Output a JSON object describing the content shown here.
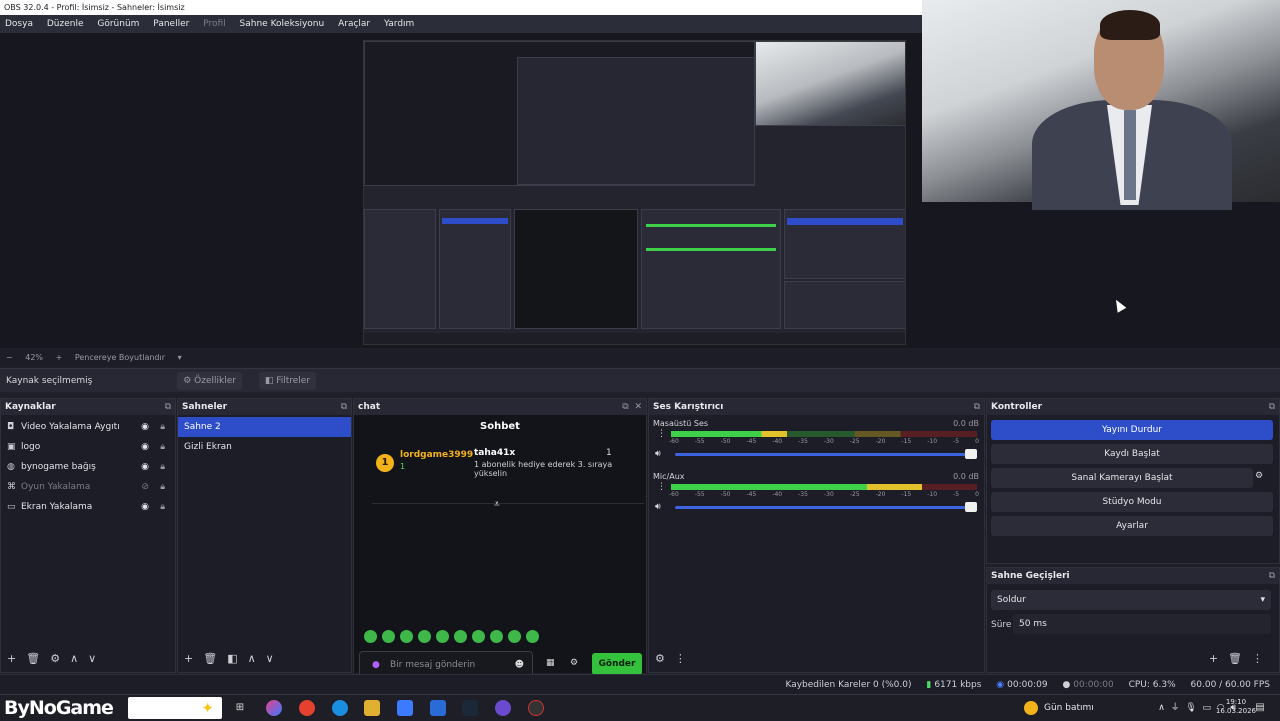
{
  "window": {
    "title": "OBS 32.0.4 - Profil: İsimsiz - Sahneler: İsimsiz"
  },
  "menu": [
    "Dosya",
    "Düzenle",
    "Görünüm",
    "Paneller",
    "Profil",
    "Sahne Koleksiyonu",
    "Araçlar",
    "Yardım"
  ],
  "zoom": {
    "minus": "−",
    "value": "42%",
    "plus": "+",
    "fit_label": "Pencereye Boyutlandır",
    "chevron": "▾"
  },
  "source_toolbar": {
    "status": "Kaynak seçilmemiş",
    "properties": "Özellikler",
    "filters": "Filtreler"
  },
  "sources": {
    "title": "Kaynaklar",
    "items": [
      {
        "label": "Video Yakalama Aygıtı",
        "icon": "camera-icon"
      },
      {
        "label": "logo",
        "icon": "image-icon"
      },
      {
        "label": "bynogame bağış",
        "icon": "globe-icon"
      },
      {
        "label": "Oyun Yakalama",
        "icon": "gamepad-icon",
        "hidden": true
      },
      {
        "label": "Ekran Yakalama",
        "icon": "monitor-icon"
      }
    ]
  },
  "scenes": {
    "title": "Sahneler",
    "items": [
      "Sahne 2",
      "Gizli Ekran"
    ],
    "selected": 0
  },
  "chat": {
    "dock_title": "chat",
    "header": "Sohbet",
    "gift": {
      "badge": "1",
      "sender": "lordgame3999",
      "sender_count": "1",
      "recipient": "taha41x",
      "recipient_count": "1",
      "message": "1 abonelik hediye ederek 3. sıraya yükselin"
    },
    "input_placeholder": "Bir mesaj gönderin",
    "send_label": "Gönder"
  },
  "mixer": {
    "title": "Ses Karıştırıcı",
    "channels": [
      {
        "name": "Masaüstü Ses",
        "db": "0.0 dB",
        "level": 0.38
      },
      {
        "name": "Mic/Aux",
        "db": "0.0 dB",
        "level": 0.82
      }
    ],
    "ticks": [
      "-60",
      "-55",
      "-50",
      "-45",
      "-40",
      "-35",
      "-30",
      "-25",
      "-20",
      "-15",
      "-10",
      "-5",
      "0"
    ]
  },
  "controls": {
    "title": "Kontroller",
    "stop_stream": "Yayını Durdur",
    "start_record": "Kaydı Başlat",
    "start_vcam": "Sanal Kamerayı Başlat",
    "studio_mode": "Stüdyo Modu",
    "settings": "Ayarlar"
  },
  "transitions": {
    "title": "Sahne Geçişleri",
    "selected": "Soldur",
    "duration_label": "Süre",
    "duration_value": "50 ms"
  },
  "status": {
    "dropped": "Kaybedilen Kareler 0 (%0.0)",
    "bitrate": "6171 kbps",
    "stream_time": "00:00:09",
    "record_time": "00:00:00",
    "cpu": "CPU: 6.3%",
    "fps": "60.00 / 60.00 FPS"
  },
  "taskbar": {
    "brand": "ByNoGame",
    "weather": "Gün batımı",
    "time": "19:10",
    "date": "16.03.2026"
  },
  "colors": {
    "accent": "#2e4ec9",
    "send_green": "#34c23d",
    "gold": "#f2b21a"
  }
}
